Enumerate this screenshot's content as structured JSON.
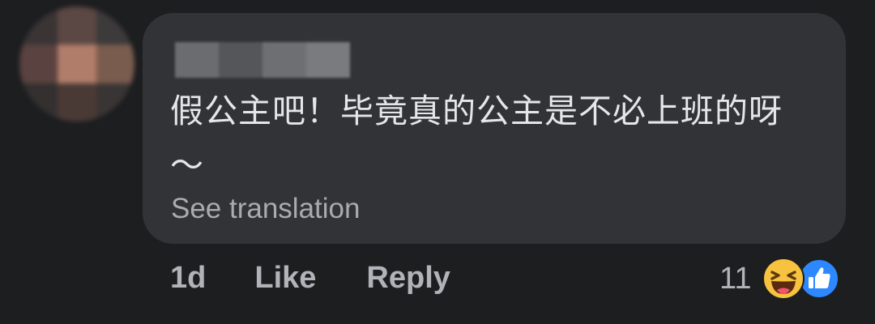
{
  "comment": {
    "text": "假公主吧！毕竟真的公主是不必上班的呀～",
    "see_translation": "See translation"
  },
  "actions": {
    "timestamp": "1d",
    "like": "Like",
    "reply": "Reply"
  },
  "reactions": {
    "count": "11",
    "icons": [
      "haha-icon",
      "like-icon"
    ]
  },
  "colors": {
    "background": "#1d1e20",
    "bubble": "#323336",
    "text": "#e4e6eb",
    "muted": "#b0b3b8",
    "like_blue": "#2d88ff",
    "haha_yellow": "#f7c23f"
  }
}
